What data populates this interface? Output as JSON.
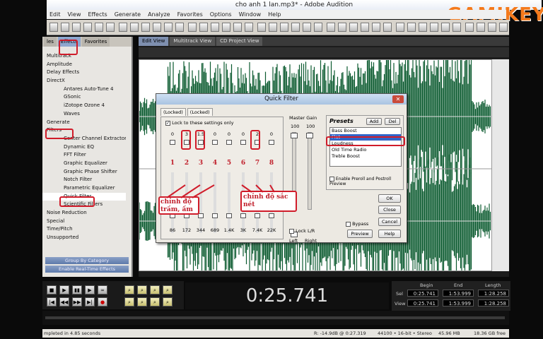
{
  "window": {
    "title": "cho anh 1 lan.mp3* - Adobe Audition"
  },
  "watermark": {
    "text": "GAMIKEY"
  },
  "menu": [
    "Edit",
    "View",
    "Effects",
    "Generate",
    "Analyze",
    "Favorites",
    "Options",
    "Window",
    "Help"
  ],
  "left_panel": {
    "tabs": [
      "les",
      "Effects",
      "Favorites"
    ],
    "tree": [
      {
        "label": "Multitrack",
        "level": 1
      },
      {
        "label": "Amplitude",
        "level": 1
      },
      {
        "label": "Delay Effects",
        "level": 1
      },
      {
        "label": "DirectX",
        "level": 1
      },
      {
        "label": "Antares Auto-Tune 4",
        "level": 2
      },
      {
        "label": "GSonic",
        "level": 2
      },
      {
        "label": "iZotope Ozone 4",
        "level": 2
      },
      {
        "label": "Waves",
        "level": 2
      },
      {
        "label": "Generate",
        "level": 1
      },
      {
        "label": "Filters",
        "level": 1
      },
      {
        "label": "Center Channel Extractor",
        "level": 2
      },
      {
        "label": "Dynamic EQ",
        "level": 2
      },
      {
        "label": "FFT Filter",
        "level": 2
      },
      {
        "label": "Graphic Equalizer",
        "level": 2
      },
      {
        "label": "Graphic Phase Shifter",
        "level": 2
      },
      {
        "label": "Notch Filter",
        "level": 2
      },
      {
        "label": "Parametric Equalizer",
        "level": 2
      },
      {
        "label": "Quick Filter",
        "level": 2
      },
      {
        "label": "Scientific Filters",
        "level": 2
      },
      {
        "label": "Noise Reduction",
        "level": 1
      },
      {
        "label": "Special",
        "level": 1
      },
      {
        "label": "Time/Pitch",
        "level": 1
      },
      {
        "label": "Unsupported",
        "level": 1
      }
    ],
    "buttons": [
      "Group By Category",
      "Enable Real-Time Effects"
    ]
  },
  "editor": {
    "tabs": [
      "Edit View",
      "Multitrack View",
      "CD Project View"
    ]
  },
  "dialog": {
    "title": "Quick Filter",
    "tabs": [
      "(Locked)",
      "(Locked)"
    ],
    "lock_label": "Lock to these settings only",
    "master_gain_label": "Master Gain",
    "master_gain_values": [
      "100",
      "100"
    ],
    "left_label": "Left",
    "right_label": "Right",
    "lock_lr_label": "Lock L/R",
    "slider_values": [
      "0",
      "3",
      "1.5",
      "0",
      "0",
      "0",
      "2",
      "0"
    ],
    "band_numbers": [
      "1",
      "2",
      "3",
      "4",
      "5",
      "6",
      "7",
      "8"
    ],
    "frequencies": [
      "86",
      "172",
      "344",
      "689",
      "1.4K",
      "3K",
      "7.4K",
      "22K"
    ],
    "presets_title": "Presets",
    "add_label": "Add",
    "del_label": "Del",
    "presets": [
      "Bass Boost",
      "Flat",
      "Loudness",
      "Old Time Radio",
      "Treble Boost"
    ],
    "selected_preset": 1,
    "preroll_label": "Enable Preroll and Postroll Preview",
    "ok_label": "OK",
    "close_label": "Close",
    "cancel_label": "Cancel",
    "bypass_label": "Bypass",
    "preview_label": "Preview",
    "help_label": "Help"
  },
  "annotations": {
    "bass_note": "chỉnh độ trầm, ấm",
    "treble_note": "chỉnh độ sắc nét"
  },
  "time_display": "0:25.741",
  "selection": {
    "headers": [
      "Begin",
      "End",
      "Length"
    ],
    "sel_label": "Sel",
    "view_label": "View",
    "sel": [
      "0:25.741",
      "1:53.999",
      "1:28.258"
    ],
    "view": [
      "0:25.741",
      "1:53.999",
      "1:28.258"
    ]
  },
  "status": {
    "left": "mpleted in 4.85 seconds",
    "level": "R: -14.9dB @  0:27.319",
    "format": "44100 • 16-bit • Stereo",
    "size": "45.96 MB",
    "free": "18.36 GB free"
  }
}
